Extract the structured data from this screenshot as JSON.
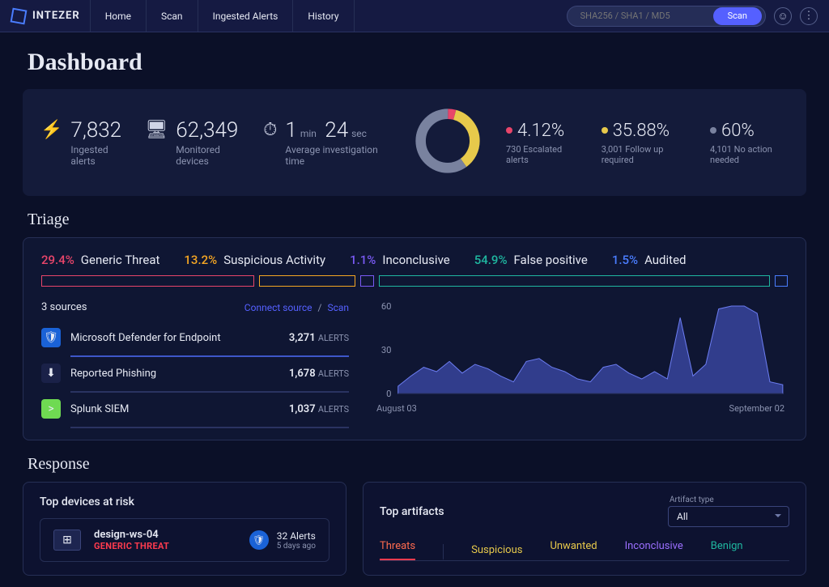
{
  "brand": "INTEZER",
  "nav": {
    "items": [
      "Home",
      "Scan",
      "Ingested Alerts",
      "History"
    ]
  },
  "search": {
    "placeholder": "SHA256 / SHA1 / MD5",
    "button": "Scan"
  },
  "page": {
    "title": "Dashboard"
  },
  "kpi": {
    "ingested": {
      "value": "7,832",
      "label": "Ingested alerts"
    },
    "monitored": {
      "value": "62,349",
      "label": "Monitored devices"
    },
    "avg_time": {
      "min": "1",
      "min_unit": "min",
      "sec": "24",
      "sec_unit": "sec",
      "label": "Average investigation time"
    }
  },
  "distribution": [
    {
      "pct": "4.12%",
      "sub": "730 Escalated alerts",
      "color": "#e8456a",
      "arc": 14.8
    },
    {
      "pct": "35.88%",
      "sub": "3,001 Follow up required",
      "color": "#e7c94b",
      "arc": 129.2
    },
    {
      "pct": "60%",
      "sub": "4,101 No action needed",
      "color": "#79829f",
      "arc": 216.0
    }
  ],
  "triage": {
    "title": "Triage",
    "legend": [
      {
        "pct": "29.4%",
        "label": "Generic Threat",
        "color": "#e8456a",
        "flex": 29.4
      },
      {
        "pct": "13.2%",
        "label": "Suspicious Activity",
        "color": "#f5a623",
        "flex": 13.2
      },
      {
        "pct": "1.1%",
        "label": "Inconclusive",
        "color": "#7a5af5",
        "flex": 1.6
      },
      {
        "pct": "54.9%",
        "label": "False positive",
        "color": "#1fb7a0",
        "flex": 54.2
      },
      {
        "pct": "1.5%",
        "label": "Audited",
        "color": "#4a7dff",
        "flex": 1.6
      }
    ],
    "sources_count": "3 sources",
    "links": {
      "connect": "Connect source",
      "scan": "Scan"
    },
    "sources": [
      {
        "name": "Microsoft Defender for Endpoint",
        "alerts": "3,271",
        "icon": "shield",
        "bg": "#1a62d7",
        "cls": "mde"
      },
      {
        "name": "Reported Phishing",
        "alerts": "1,678",
        "icon": "download",
        "bg": "#1a2148",
        "cls": ""
      },
      {
        "name": "Splunk SIEM",
        "alerts": "1,037",
        "icon": "splunk",
        "bg": "#6fda52",
        "cls": ""
      }
    ],
    "alerts_word": "ALERTS"
  },
  "chart_data": {
    "type": "area",
    "ylim": [
      0,
      60
    ],
    "yticks": [
      0,
      30,
      60
    ],
    "xrange": [
      "August 03",
      "September 02"
    ],
    "x": [
      0,
      1,
      2,
      3,
      4,
      5,
      6,
      7,
      8,
      9,
      10,
      11,
      12,
      13,
      14,
      15,
      16,
      17,
      18,
      19,
      20,
      21,
      22,
      23,
      24,
      25,
      26,
      27,
      28,
      29,
      30
    ],
    "y": [
      5,
      12,
      18,
      15,
      22,
      14,
      20,
      17,
      12,
      8,
      22,
      24,
      18,
      15,
      10,
      8,
      18,
      20,
      14,
      10,
      15,
      10,
      52,
      12,
      20,
      58,
      62,
      60,
      55,
      8,
      6
    ]
  },
  "response": {
    "title": "Response",
    "left_title": "Top devices at risk",
    "device": {
      "name": "design-ws-04",
      "tag": "GENERIC THREAT",
      "alerts_n": "32 Alerts",
      "when": "5 days ago"
    },
    "right_title": "Top artifacts",
    "filter": {
      "label": "Artifact type",
      "value": "All"
    },
    "tabs": [
      {
        "label": "Threats",
        "color": "#ff6b4e",
        "active": true
      },
      {
        "label": "Suspicious",
        "color": "#e7c94b",
        "divider": true
      },
      {
        "label": "Unwanted",
        "color": "#e7c94b"
      },
      {
        "label": "Inconclusive",
        "color": "#9b6fff"
      },
      {
        "label": "Benign",
        "color": "#1fb7a0"
      }
    ]
  }
}
